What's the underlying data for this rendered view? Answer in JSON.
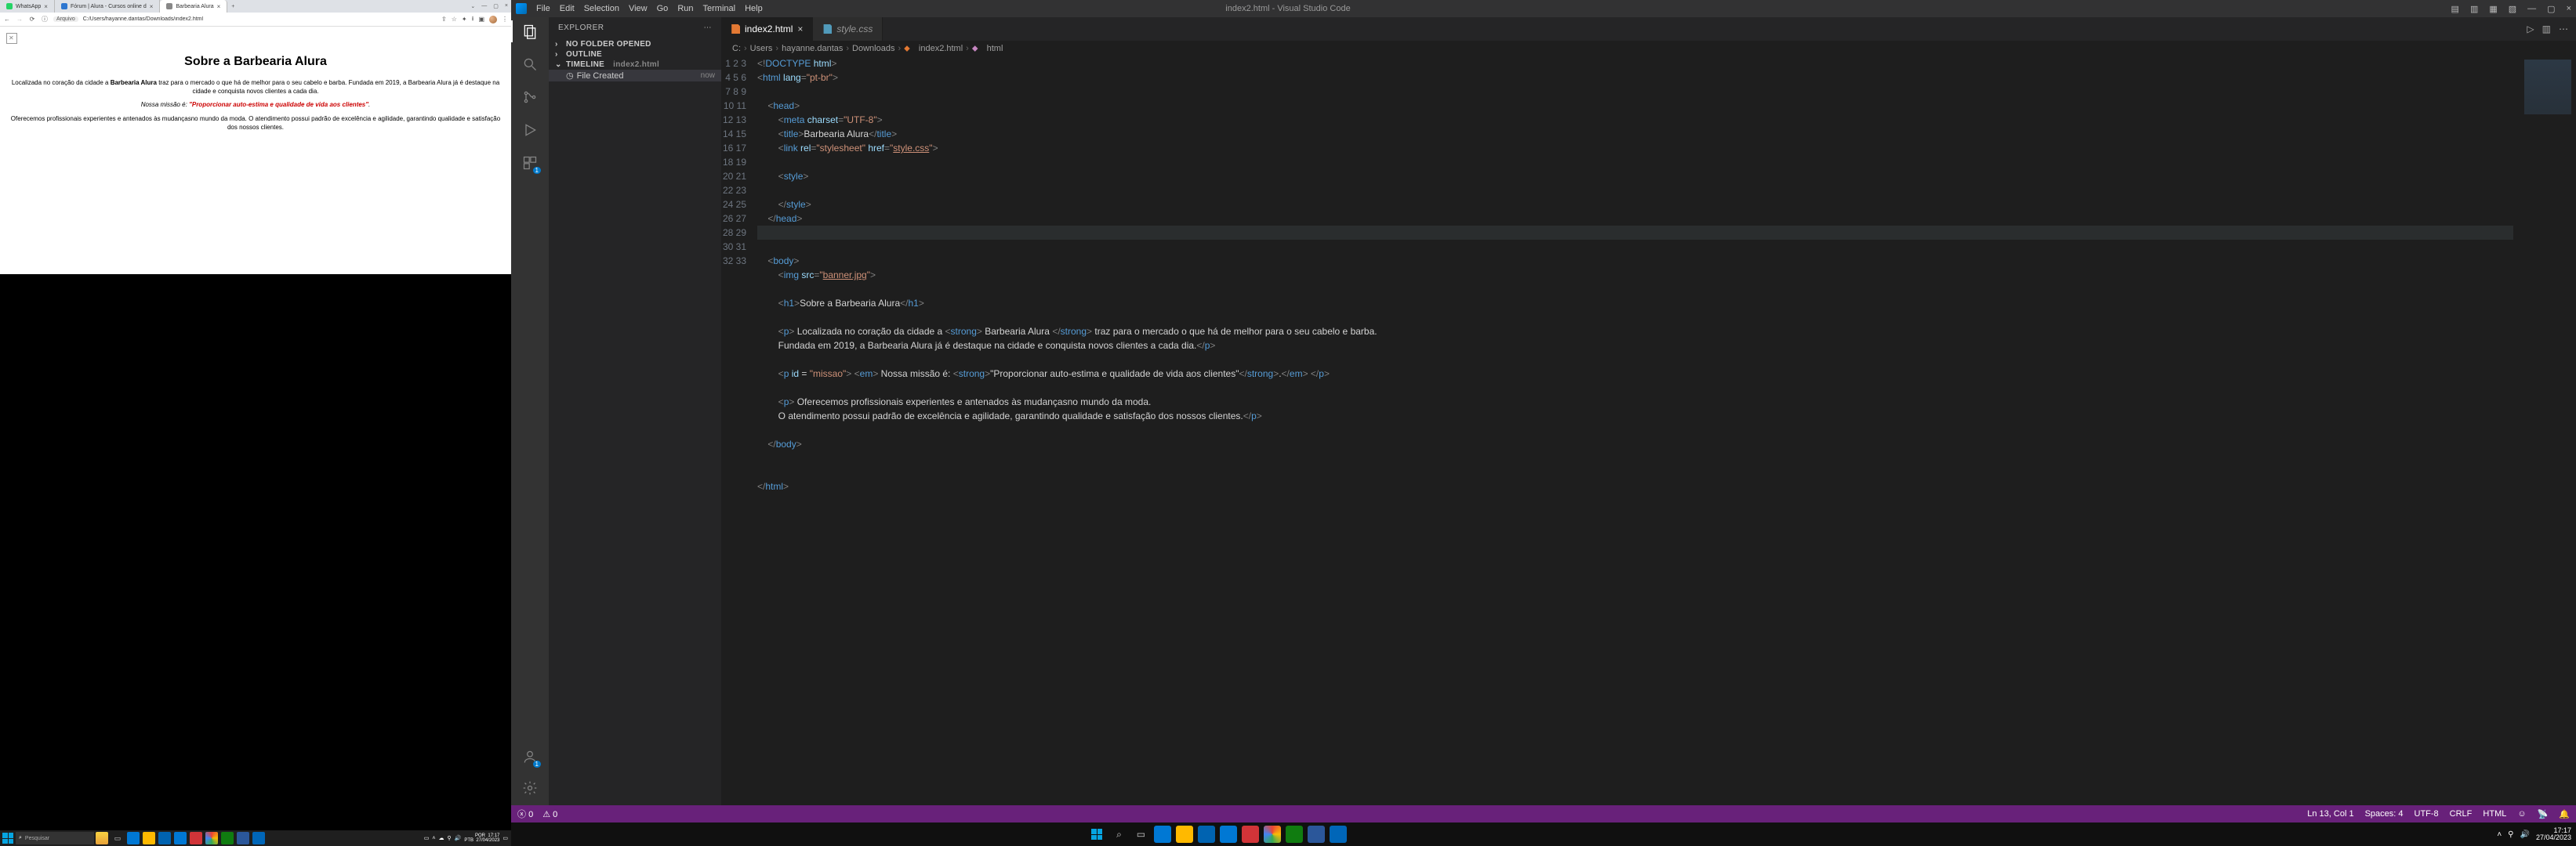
{
  "browser": {
    "tabs": [
      {
        "label": "WhatsApp",
        "fav": "#25d366"
      },
      {
        "label": "Fórum | Alura - Cursos online d",
        "fav": "#2e77d0"
      },
      {
        "label": "Barbearia Alura",
        "fav": "#888888",
        "active": true
      }
    ],
    "addr_prefix": "Arquivo",
    "url": "C:/Users/hayanne.dantas/Downloads/index2.html",
    "page": {
      "h1": "Sobre a Barbearia Alura",
      "p1_a": "Localizada no coração da cidade a ",
      "p1_b": "Barbearia Alura",
      "p1_c": " traz para o mercado o que há de melhor para o seu cabelo e barba. Fundada em 2019, a Barbearia Alura já é destaque na cidade e conquista novos clientes a cada dia.",
      "p2_a": "Nossa missão é: ",
      "p2_b": "\"Proporcionar auto-estima e qualidade de vida aos clientes\"",
      "p2_c": ".",
      "p3": "Oferecemos profissionais experientes e antenados às mudançasno mundo da moda. O atendimento possui padrão de excelência e agilidade, garantindo qualidade e satisfação dos nossos clientes."
    }
  },
  "taskbar": {
    "search_placeholder": "Pesquisar",
    "lang_top": "POR",
    "lang_bot": "PTB",
    "time": "17:17",
    "date": "27/04/2023"
  },
  "vscode": {
    "title": "index2.html - Visual Studio Code",
    "menus": [
      "File",
      "Edit",
      "Selection",
      "View",
      "Go",
      "Run",
      "Terminal",
      "Help"
    ],
    "explorer": {
      "title": "EXPLORER",
      "sections": {
        "nofolder": "NO FOLDER OPENED",
        "outline": "OUTLINE",
        "timeline": "TIMELINE",
        "timeline_file": "index2.html",
        "event": "File Created",
        "event_time": "now"
      }
    },
    "tabs": [
      {
        "label": "index2.html",
        "color": "#e37933",
        "active": true
      },
      {
        "label": "style.css",
        "color": "#519aba"
      }
    ],
    "crumbs": [
      "C:",
      "Users",
      "hayanne.dantas",
      "Downloads",
      "index2.html",
      "html"
    ],
    "status": {
      "errors": "0",
      "warnings": "0",
      "ln": "Ln 13, Col 1",
      "spaces": "Spaces: 4",
      "enc": "UTF-8",
      "eol": "CRLF",
      "lang": "HTML"
    },
    "code": {
      "l1": "<!DOCTYPE html>",
      "l2a": "<html ",
      "l2b": "lang",
      "l2c": "=\"pt-br\">",
      "l4": "<head>",
      "l5a": "<meta ",
      "l5b": "charset",
      "l5c": "=\"UTF-8\">",
      "l6a": "<title>",
      "l6b": "Barbearia Alura",
      "l6c": "</title>",
      "l7a": "<link ",
      "l7b": "rel",
      "l7c": "=\"stylesheet\" ",
      "l7d": "href",
      "l7e": "=\"",
      "l7f": "style.css",
      "l7g": "\">",
      "l9": "<style>",
      "l11": "</style>",
      "l12": "</head>",
      "l15": "<body>",
      "l16a": "<img ",
      "l16b": "src",
      "l16c": "=\"",
      "l16d": "banner.jpg",
      "l16e": "\">",
      "l18a": "<h1>",
      "l18b": "Sobre a Barbearia Alura",
      "l18c": "</h1>",
      "l20a": "<p>",
      "l20b": " Localizada no coração da cidade a ",
      "l20c": "<strong>",
      "l20d": " Barbearia Alura ",
      "l20e": "</strong>",
      "l20f": " traz para o mercado o que há de melhor para o seu cabelo e barba.",
      "l21a": "Fundada em 2019, a Barbearia Alura já é destaque na cidade e conquista novos clientes a cada dia.",
      "l21b": "</p>",
      "l23a": "<p ",
      "l23b": "id",
      "l23c": " = \"missao\">",
      "l23d": " <em>",
      "l23e": " Nossa missão é: ",
      "l23f": "<strong>",
      "l23g": "\"Proporcionar auto-estima e qualidade de vida aos clientes\"",
      "l23h": "</strong>",
      "l23i": ".",
      "l23j": "</em>",
      "l23k": " </p>",
      "l25a": "<p>",
      "l25b": " Oferecemos profissionais experientes e antenados às mudançasno mundo da moda.",
      "l26a": "O atendimento possui padrão de excelência e agilidade, garantindo qualidade e satisfação dos nossos clientes.",
      "l26b": "</p>",
      "l28": "</body>",
      "l31": "</html>"
    }
  },
  "taskbar2": {
    "time": "17:17",
    "date": "27/04/2023"
  }
}
